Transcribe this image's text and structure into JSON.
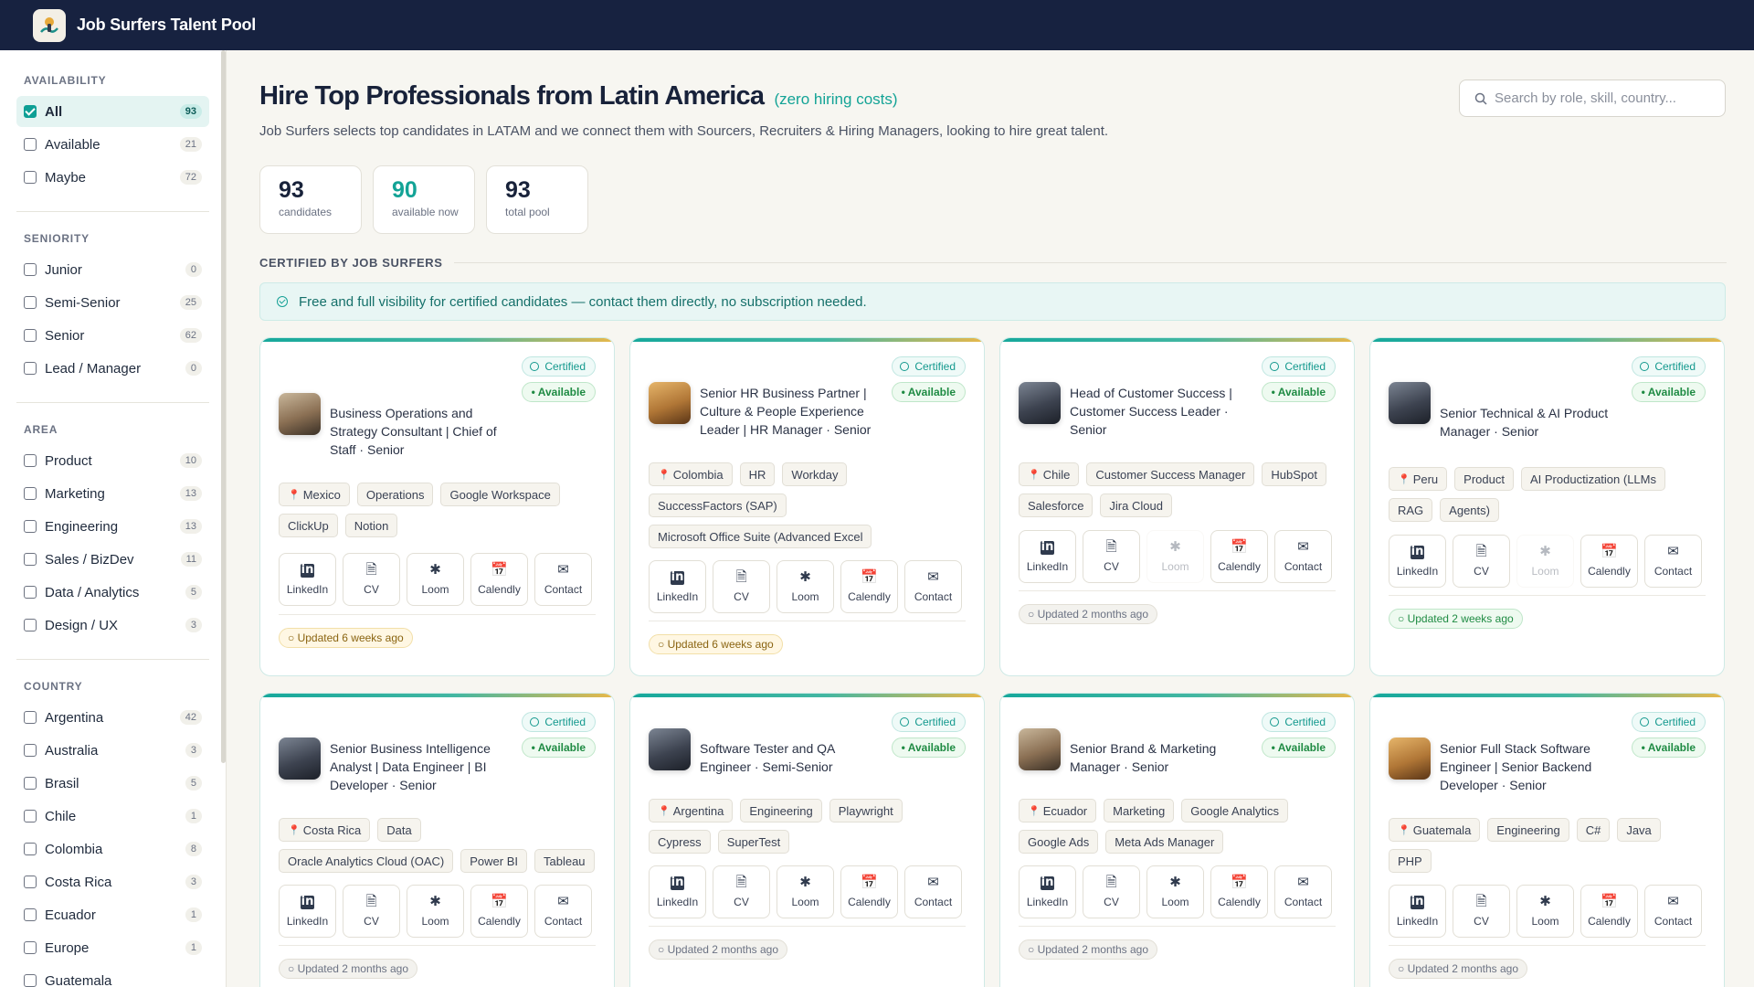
{
  "app": {
    "title": "Job Surfers Talent Pool"
  },
  "sidebar": {
    "availability": {
      "heading": "AVAILABILITY",
      "items": [
        {
          "label": "All",
          "count": "93",
          "checked": true
        },
        {
          "label": "Available",
          "count": "21",
          "checked": false
        },
        {
          "label": "Maybe",
          "count": "72",
          "checked": false
        }
      ]
    },
    "seniority": {
      "heading": "SENIORITY",
      "items": [
        {
          "label": "Junior",
          "count": "0"
        },
        {
          "label": "Semi-Senior",
          "count": "25"
        },
        {
          "label": "Senior",
          "count": "62"
        },
        {
          "label": "Lead / Manager",
          "count": "0"
        }
      ]
    },
    "area": {
      "heading": "AREA",
      "items": [
        {
          "label": "Product",
          "count": "10"
        },
        {
          "label": "Marketing",
          "count": "13"
        },
        {
          "label": "Engineering",
          "count": "13"
        },
        {
          "label": "Sales / BizDev",
          "count": "11"
        },
        {
          "label": "Data / Analytics",
          "count": "5"
        },
        {
          "label": "Design / UX",
          "count": "3"
        }
      ]
    },
    "country": {
      "heading": "COUNTRY",
      "items": [
        {
          "label": "Argentina",
          "count": "42"
        },
        {
          "label": "Australia",
          "count": "3"
        },
        {
          "label": "Brasil",
          "count": "5"
        },
        {
          "label": "Chile",
          "count": "1"
        },
        {
          "label": "Colombia",
          "count": "8"
        },
        {
          "label": "Costa Rica",
          "count": "3"
        },
        {
          "label": "Ecuador",
          "count": "1"
        },
        {
          "label": "Europe",
          "count": "1"
        },
        {
          "label": "Guatemala",
          "count": ""
        }
      ]
    }
  },
  "main": {
    "title": "Hire Top Professionals from Latin America",
    "title_accent": "(zero hiring costs)",
    "subtitle": "Job Surfers selects top candidates in LATAM and we connect them with Sourcers, Recruiters & Hiring Managers, looking to hire great talent.",
    "search": {
      "placeholder": "Search by role, skill, country..."
    },
    "stats": [
      {
        "value": "93",
        "label": "candidates"
      },
      {
        "value": "90",
        "label": "available now"
      },
      {
        "value": "93",
        "label": "total pool"
      }
    ],
    "section_title": "CERTIFIED BY JOB SURFERS",
    "banner": "Free and full visibility for certified candidates — contact them directly, no subscription needed."
  },
  "card_labels": {
    "certified": "Certified",
    "available": "• Available",
    "actions": [
      "LinkedIn",
      "CV",
      "Loom",
      "Calendly",
      "Contact"
    ]
  },
  "cards": [
    {
      "role": "Business Operations and Strategy Consultant | Chief of Staff · Senior",
      "country": "Mexico",
      "tags": [
        "Operations",
        "Google Workspace",
        "ClickUp",
        "Notion"
      ],
      "updated": "○ Updated 6 weeks ago",
      "loom": true
    },
    {
      "role": "Senior HR Business Partner | Culture & People Experience Leader | HR Manager · Senior",
      "country": "Colombia",
      "tags": [
        "HR",
        "Workday",
        "SuccessFactors (SAP)",
        "Microsoft Office Suite (Advanced Excel"
      ],
      "updated": "○ Updated 6 weeks ago",
      "loom": true
    },
    {
      "role": "Head of Customer Success | Customer Success Leader · Senior",
      "country": "Chile",
      "tags": [
        "Customer Success Manager",
        "HubSpot",
        "Salesforce",
        "Jira Cloud"
      ],
      "updated": "○ Updated 2 months ago",
      "loom": false
    },
    {
      "role": "Senior Technical & AI Product Manager · Senior",
      "country": "Peru",
      "tags": [
        "Product",
        "AI Productization (LLMs",
        "RAG",
        "Agents)"
      ],
      "updated": "○ Updated 2 weeks ago",
      "loom": false
    },
    {
      "role": "Senior Business Intelligence Analyst | Data Engineer | BI Developer · Senior",
      "country": "Costa Rica",
      "tags": [
        "Data",
        "Oracle Analytics Cloud (OAC)",
        "Power BI",
        "Tableau"
      ],
      "updated": "○ Updated 2 months ago",
      "loom": true
    },
    {
      "role": "Software Tester and QA Engineer · Semi-Senior",
      "country": "Argentina",
      "tags": [
        "Engineering",
        "Playwright",
        "Cypress",
        "SuperTest"
      ],
      "updated": "○ Updated 2 months ago",
      "loom": true
    },
    {
      "role": "Senior Brand & Marketing Manager · Senior",
      "country": "Ecuador",
      "tags": [
        "Marketing",
        "Google Analytics",
        "Google Ads",
        "Meta Ads Manager"
      ],
      "updated": "○ Updated 2 months ago",
      "loom": true
    },
    {
      "role": "Senior Full Stack Software Engineer | Senior Backend Developer · Senior",
      "country": "Guatemala",
      "tags": [
        "Engineering",
        "C#",
        "Java",
        "PHP"
      ],
      "updated": "○ Updated 2 months ago",
      "loom": true
    }
  ],
  "colors": {
    "navy": "#172240",
    "teal": "#13a396",
    "amber": "#e8b84a"
  }
}
